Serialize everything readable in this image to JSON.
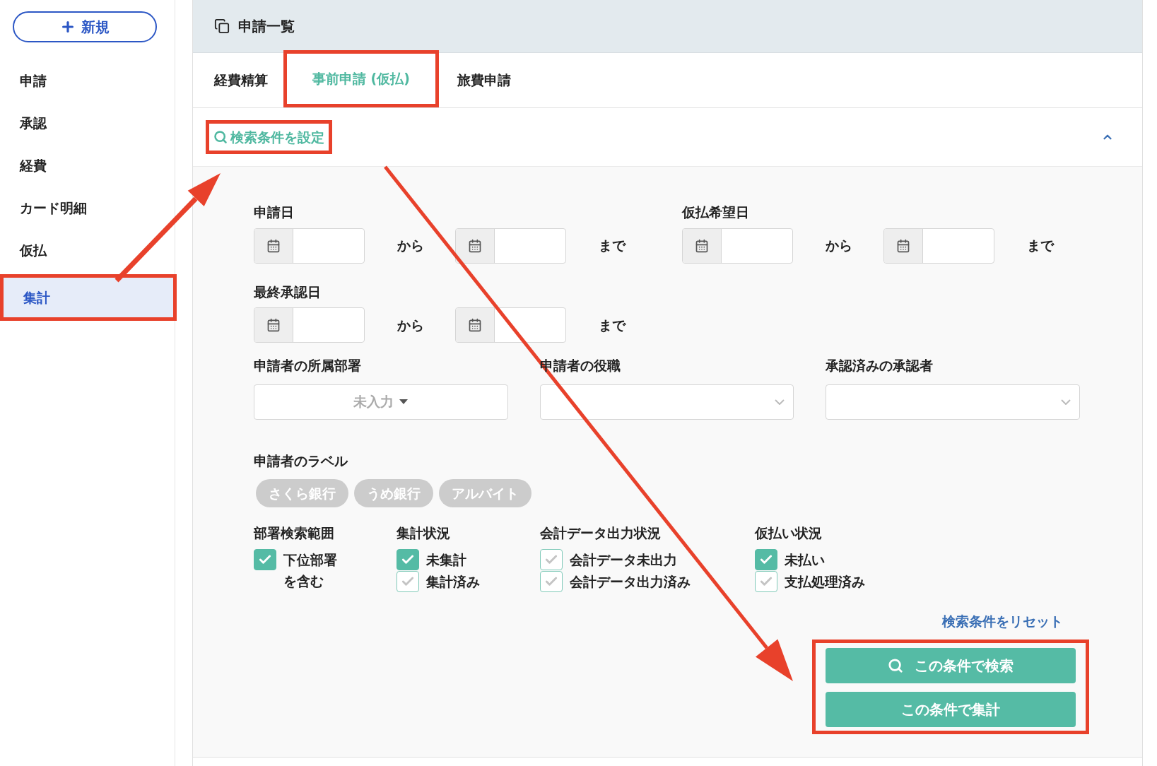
{
  "new_button": {
    "label": "新規"
  },
  "sidebar": {
    "items": [
      {
        "label": "申請",
        "selected": false
      },
      {
        "label": "承認",
        "selected": false
      },
      {
        "label": "経費",
        "selected": false
      },
      {
        "label": "カード明細",
        "selected": false
      },
      {
        "label": "仮払",
        "selected": false
      },
      {
        "label": "集計",
        "selected": true
      }
    ]
  },
  "header": {
    "title": "申請一覧"
  },
  "tabs": [
    {
      "label": "経費精算",
      "selected": false
    },
    {
      "label": "事前申請 (仮払)",
      "selected": true
    },
    {
      "label": "旅費申請",
      "selected": false
    }
  ],
  "search_toggle": {
    "label": "検索条件を設定",
    "expanded": true
  },
  "date_filters": [
    {
      "label": "申請日",
      "from": "から",
      "to": "まで"
    },
    {
      "label": "仮払希望日",
      "from": "から",
      "to": "まで"
    },
    {
      "label": "最終承認日",
      "from": "から",
      "to": "まで"
    }
  ],
  "selects": [
    {
      "label": "申請者の所属部署",
      "kind": "multiselect",
      "placeholder": "未入力"
    },
    {
      "label": "申請者の役職",
      "kind": "select"
    },
    {
      "label": "承認済みの承認者",
      "kind": "select"
    }
  ],
  "applicant_labels": {
    "title": "申請者のラベル",
    "tags": [
      "さくら銀行",
      "うめ銀行",
      "アルバイト"
    ]
  },
  "checkbox_groups": [
    {
      "title": "部署検索範囲",
      "options": [
        {
          "label": "下位部署を含む",
          "checked": true
        }
      ]
    },
    {
      "title": "集計状況",
      "options": [
        {
          "label": "未集計",
          "checked": true
        },
        {
          "label": "集計済み",
          "checked": false
        }
      ]
    },
    {
      "title": "会計データ出力状況",
      "options": [
        {
          "label": "会計データ未出力",
          "checked": false
        },
        {
          "label": "会計データ出力済み",
          "checked": false
        }
      ]
    },
    {
      "title": "仮払い状況",
      "options": [
        {
          "label": "未払い",
          "checked": true
        },
        {
          "label": "支払処理済み",
          "checked": false
        }
      ]
    }
  ],
  "reset_link": {
    "label": "検索条件をリセット"
  },
  "buttons": [
    {
      "label": "この条件で検索",
      "kind": "search"
    },
    {
      "label": "この条件で集計",
      "kind": "plain"
    }
  ]
}
